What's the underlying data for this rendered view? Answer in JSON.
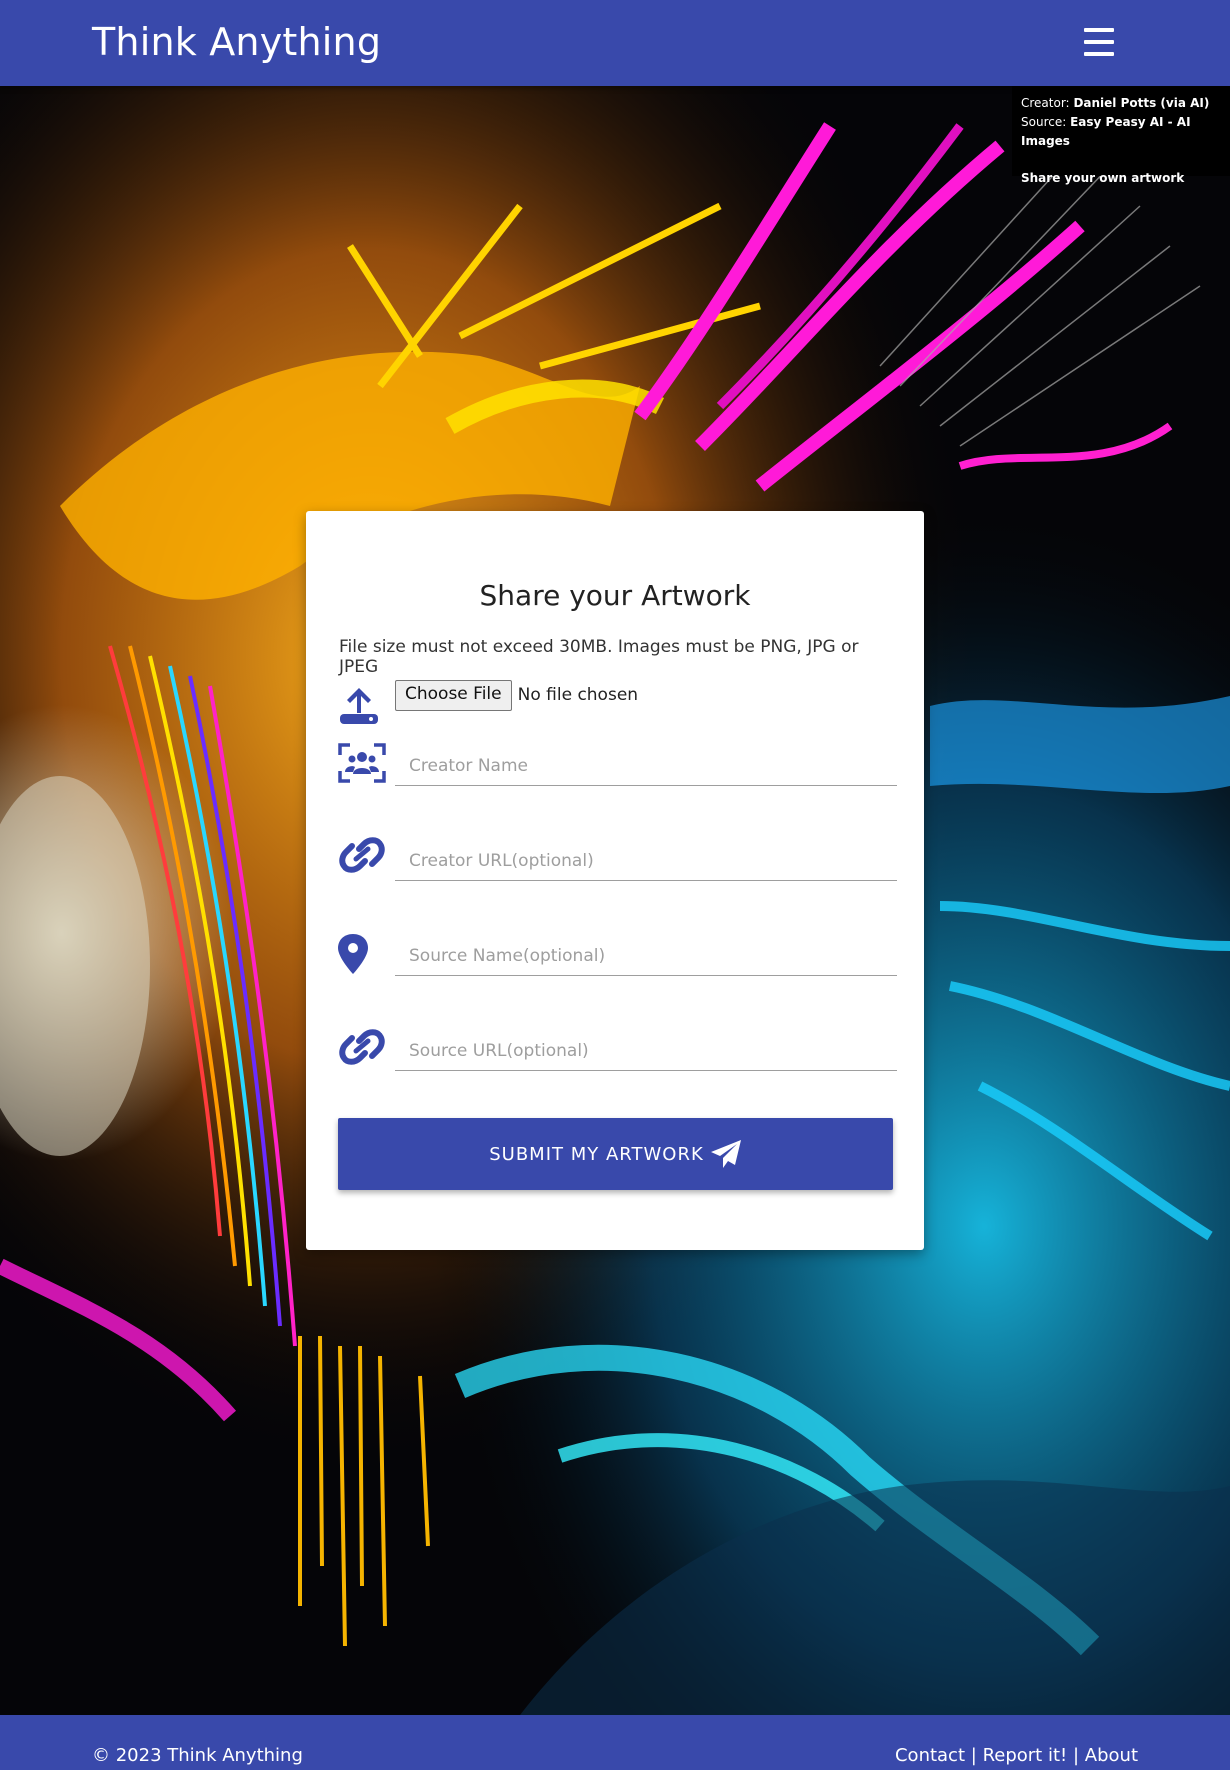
{
  "header": {
    "brand": "Think Anything",
    "menu_icon": "hamburger-menu-icon"
  },
  "credit": {
    "creator_label": "Creator:",
    "creator_name": "Daniel Potts (via AI)",
    "source_label": "Source:",
    "source_name": "Easy Peasy AI - AI Images",
    "share_link": "Share your own artwork"
  },
  "form": {
    "title": "Share your Artwork",
    "note": "File size must not exceed 30MB. Images must be PNG, JPG or JPEG",
    "file_button": "Choose File",
    "file_status": "No file chosen",
    "creator_name_placeholder": "Creator Name",
    "creator_url_placeholder": "Creator URL(optional)",
    "source_name_placeholder": "Source Name(optional)",
    "source_url_placeholder": "Source URL(optional)",
    "submit_label": "SUBMIT MY ARTWORK",
    "icons": [
      "upload-icon",
      "users-icon",
      "link-icon",
      "location-pin-icon",
      "link-icon",
      "paper-plane-icon"
    ]
  },
  "footer": {
    "copyright": "© 2023 Think Anything",
    "links": {
      "contact": "Contact",
      "report": "Report it!",
      "about": "About"
    },
    "separator": "|"
  },
  "colors": {
    "primary": "#3949ab",
    "background": "#040406",
    "card": "#ffffff"
  }
}
